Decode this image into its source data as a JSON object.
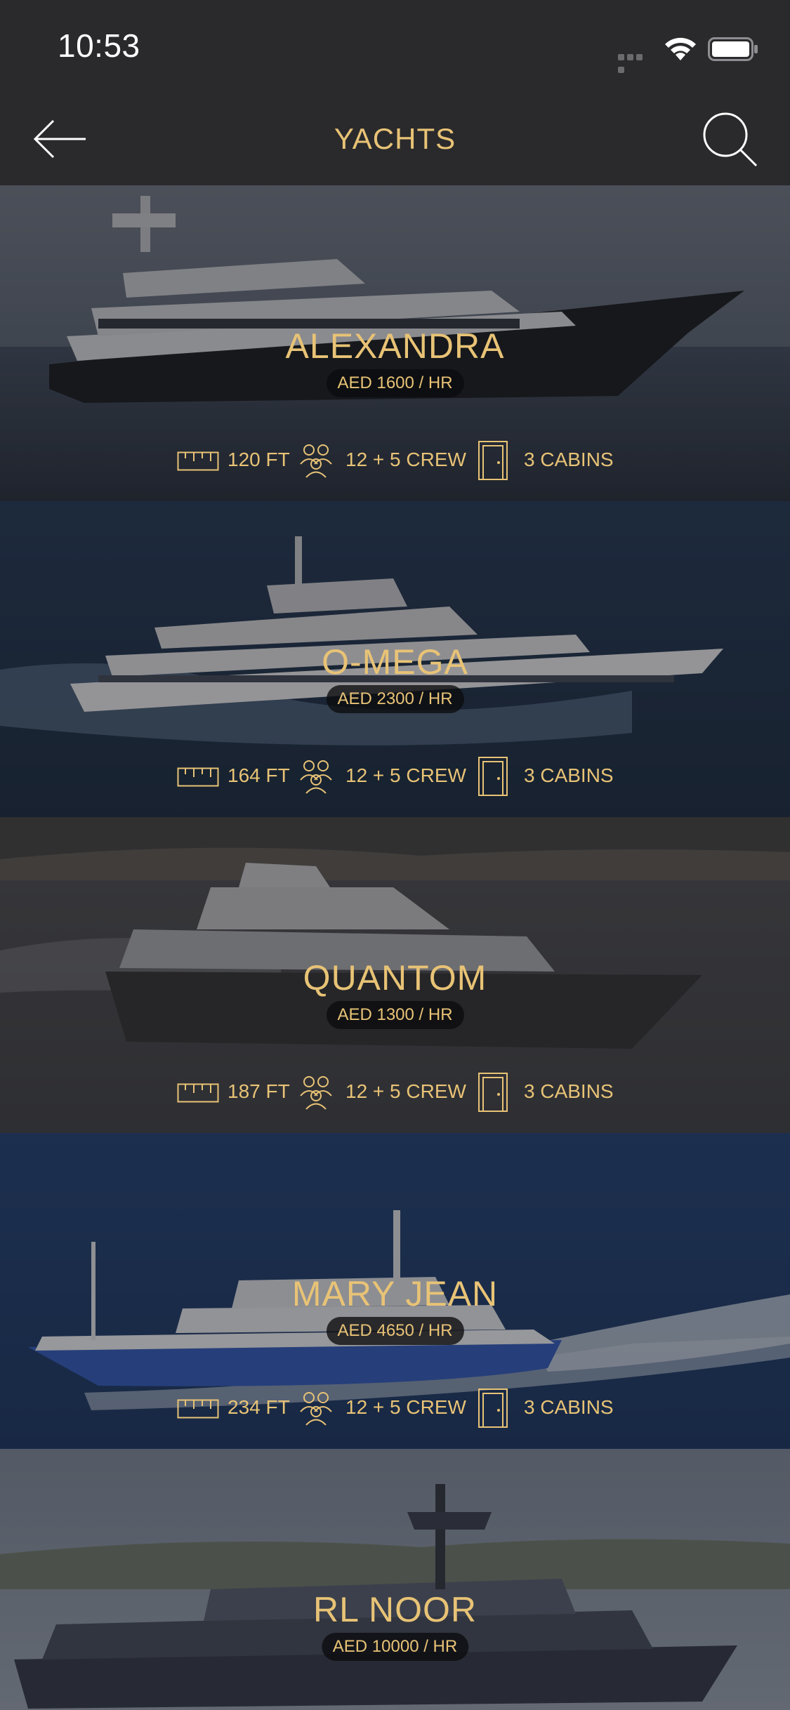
{
  "status_bar": {
    "time": "10:53"
  },
  "nav": {
    "title": "YACHTS"
  },
  "yachts": [
    {
      "name": "ALEXANDRA",
      "price": "AED 1600 / HR",
      "length": "120 FT",
      "crew": "12 + 5 CREW",
      "cabins": "3 CABINS"
    },
    {
      "name": "O-MEGA",
      "price": "AED 2300 / HR",
      "length": "164 FT",
      "crew": "12 + 5 CREW",
      "cabins": "3 CABINS"
    },
    {
      "name": "QUANTOM",
      "price": "AED 1300 / HR",
      "length": "187 FT",
      "crew": "12 + 5 CREW",
      "cabins": "3 CABINS"
    },
    {
      "name": "MARY JEAN",
      "price": "AED 4650 / HR",
      "length": "234 FT",
      "crew": "12 + 5 CREW",
      "cabins": "3 CABINS"
    },
    {
      "name": "RL NOOR",
      "price": "AED 10000 / HR"
    }
  ],
  "colors": {
    "accent": "#e8c376",
    "bar": "#2a2a2c"
  },
  "icons": {
    "back": "arrow-left-icon",
    "search": "search-icon",
    "length": "ruler-icon",
    "crew": "people-icon",
    "cabins": "door-icon"
  }
}
